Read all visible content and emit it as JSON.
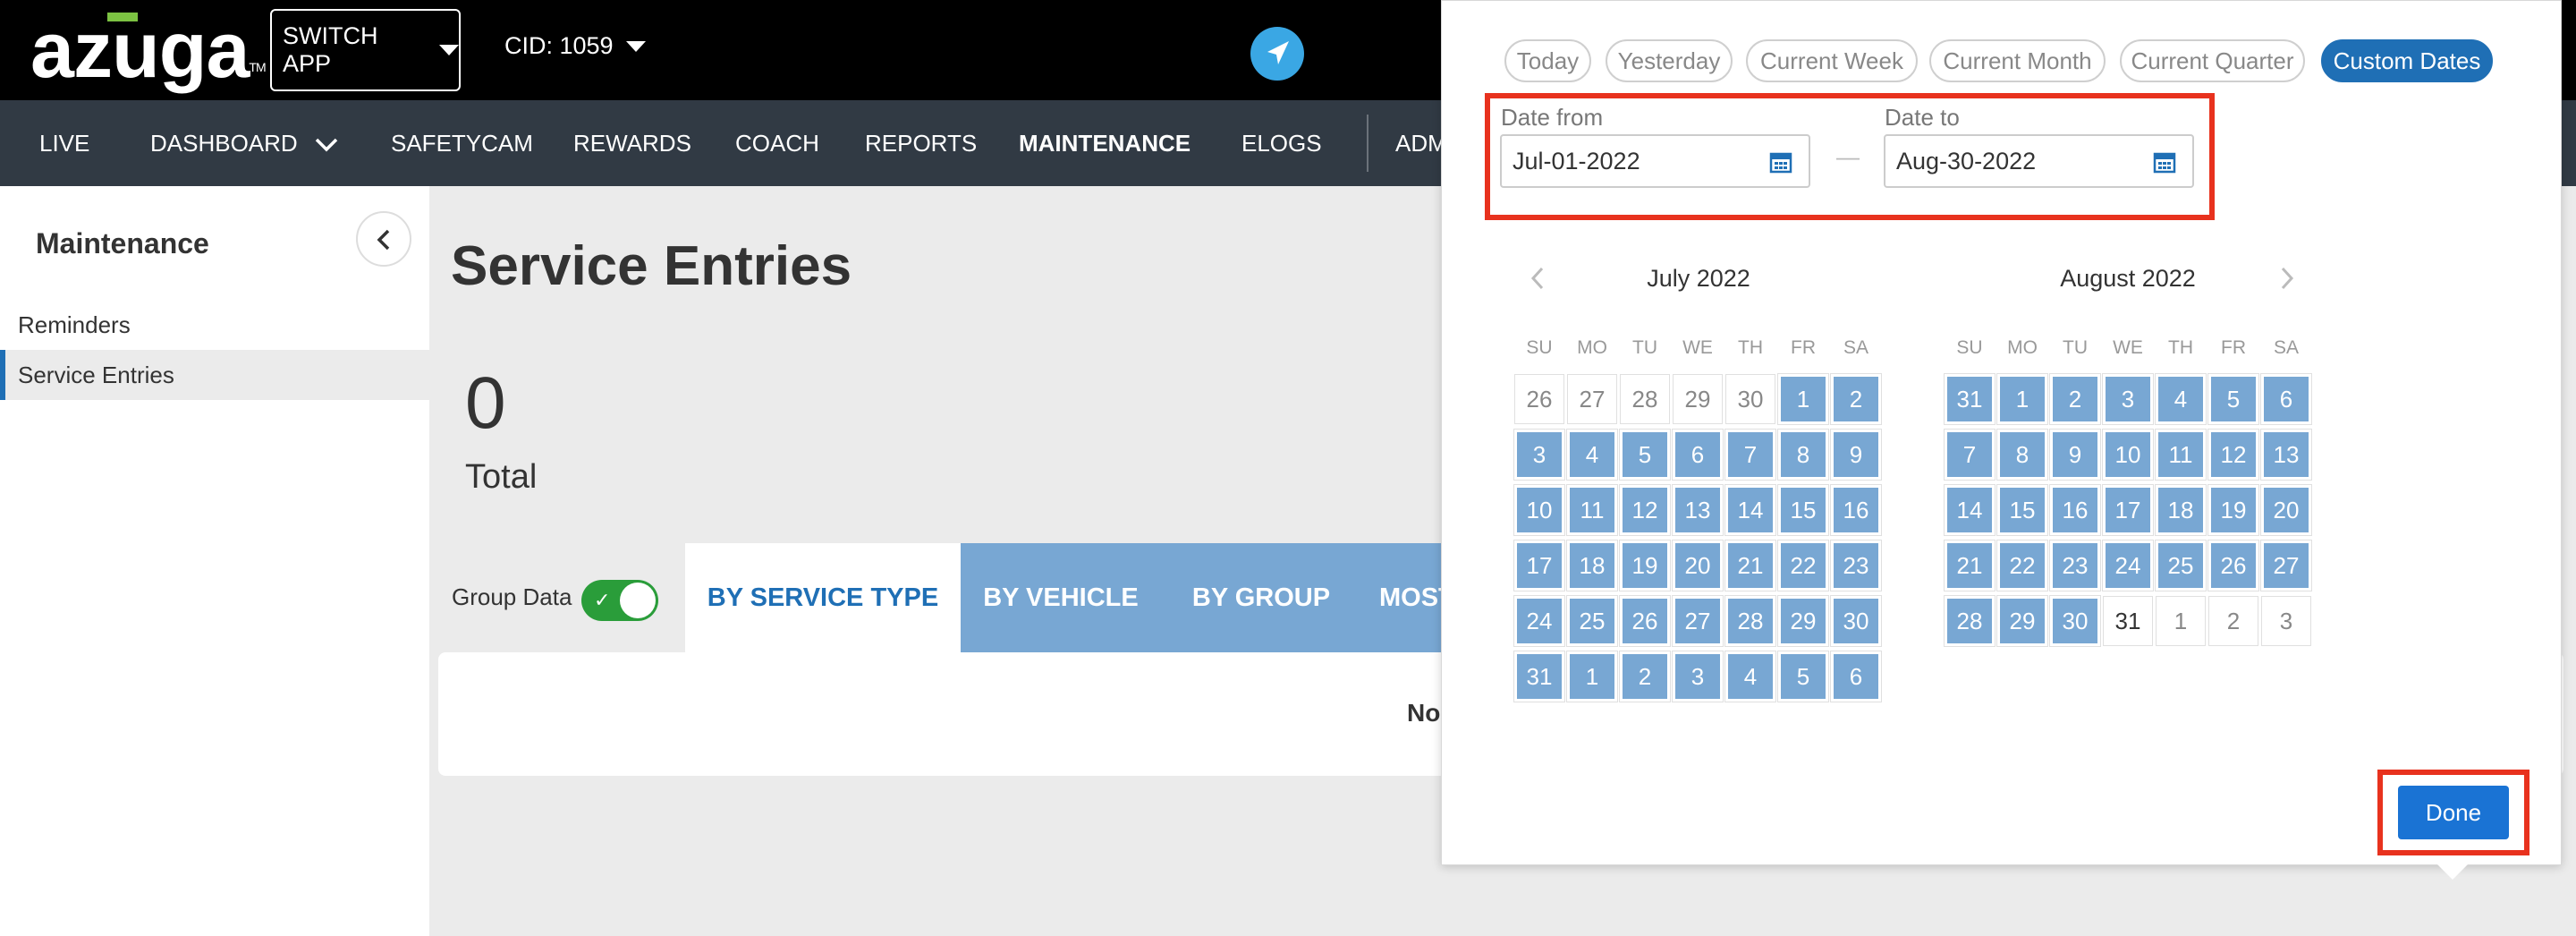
{
  "header": {
    "logo_text": "azuga",
    "logo_tm": "TM",
    "switch_app_label": "SWITCH APP",
    "cid_label": "CID: 1059"
  },
  "nav": {
    "items": [
      "LIVE",
      "DASHBOARD",
      "SAFETYCAM",
      "REWARDS",
      "COACH",
      "REPORTS",
      "MAINTENANCE",
      "ELOGS",
      "ADM"
    ],
    "active": "MAINTENANCE"
  },
  "sidebar": {
    "title": "Maintenance",
    "items": [
      {
        "label": "Reminders",
        "active": false
      },
      {
        "label": "Service Entries",
        "active": true
      }
    ]
  },
  "main": {
    "page_title": "Service Entries",
    "total_value": "0",
    "total_label": "Total",
    "group_data_label": "Group Data",
    "group_data_on": true,
    "tabs": [
      "BY SERVICE TYPE",
      "BY VEHICLE",
      "BY GROUP",
      "MOST"
    ],
    "active_tab": "BY SERVICE TYPE",
    "no_results_partial": "No"
  },
  "date_picker": {
    "presets": [
      "Today",
      "Yesterday",
      "Current Week",
      "Current Month",
      "Current Quarter",
      "Custom Dates"
    ],
    "active_preset": "Custom Dates",
    "date_from_label": "Date from",
    "date_from_value": "Jul-01-2022",
    "date_to_label": "Date to",
    "date_to_value": "Aug-30-2022",
    "separator": "—",
    "weekdays": [
      "SU",
      "MO",
      "TU",
      "WE",
      "TH",
      "FR",
      "SA"
    ],
    "months": [
      {
        "title": "July 2022",
        "weeks": [
          [
            "26",
            "27",
            "28",
            "29",
            "30",
            "1",
            "2"
          ],
          [
            "3",
            "4",
            "5",
            "6",
            "7",
            "8",
            "9"
          ],
          [
            "10",
            "11",
            "12",
            "13",
            "14",
            "15",
            "16"
          ],
          [
            "17",
            "18",
            "19",
            "20",
            "21",
            "22",
            "23"
          ],
          [
            "24",
            "25",
            "26",
            "27",
            "28",
            "29",
            "30"
          ],
          [
            "31",
            "1",
            "2",
            "3",
            "4",
            "5",
            "6"
          ]
        ],
        "states": [
          [
            "o",
            "o",
            "o",
            "o",
            "o",
            "s",
            "s"
          ],
          [
            "s",
            "s",
            "s",
            "s",
            "s",
            "s",
            "s"
          ],
          [
            "s",
            "s",
            "s",
            "s",
            "s",
            "s",
            "s"
          ],
          [
            "s",
            "s",
            "s",
            "s",
            "s",
            "s",
            "s"
          ],
          [
            "s",
            "s",
            "s",
            "s",
            "s",
            "s",
            "s"
          ],
          [
            "s",
            "s",
            "s",
            "s",
            "s",
            "s",
            "s"
          ]
        ]
      },
      {
        "title": "August 2022",
        "weeks": [
          [
            "31",
            "1",
            "2",
            "3",
            "4",
            "5",
            "6"
          ],
          [
            "7",
            "8",
            "9",
            "10",
            "11",
            "12",
            "13"
          ],
          [
            "14",
            "15",
            "16",
            "17",
            "18",
            "19",
            "20"
          ],
          [
            "21",
            "22",
            "23",
            "24",
            "25",
            "26",
            "27"
          ],
          [
            "28",
            "29",
            "30",
            "31",
            "1",
            "2",
            "3"
          ]
        ],
        "states": [
          [
            "s",
            "s",
            "s",
            "s",
            "s",
            "s",
            "s"
          ],
          [
            "s",
            "s",
            "s",
            "s",
            "s",
            "s",
            "s"
          ],
          [
            "s",
            "s",
            "s",
            "s",
            "s",
            "s",
            "s"
          ],
          [
            "s",
            "s",
            "s",
            "s",
            "s",
            "s",
            "s"
          ],
          [
            "s",
            "s",
            "s",
            "n",
            "o",
            "o",
            "o"
          ]
        ]
      }
    ],
    "done_label": "Done",
    "colors": {
      "selected_day": "#78a7d3",
      "primary": "#1f6fb5",
      "highlight": "#e8321e"
    }
  }
}
